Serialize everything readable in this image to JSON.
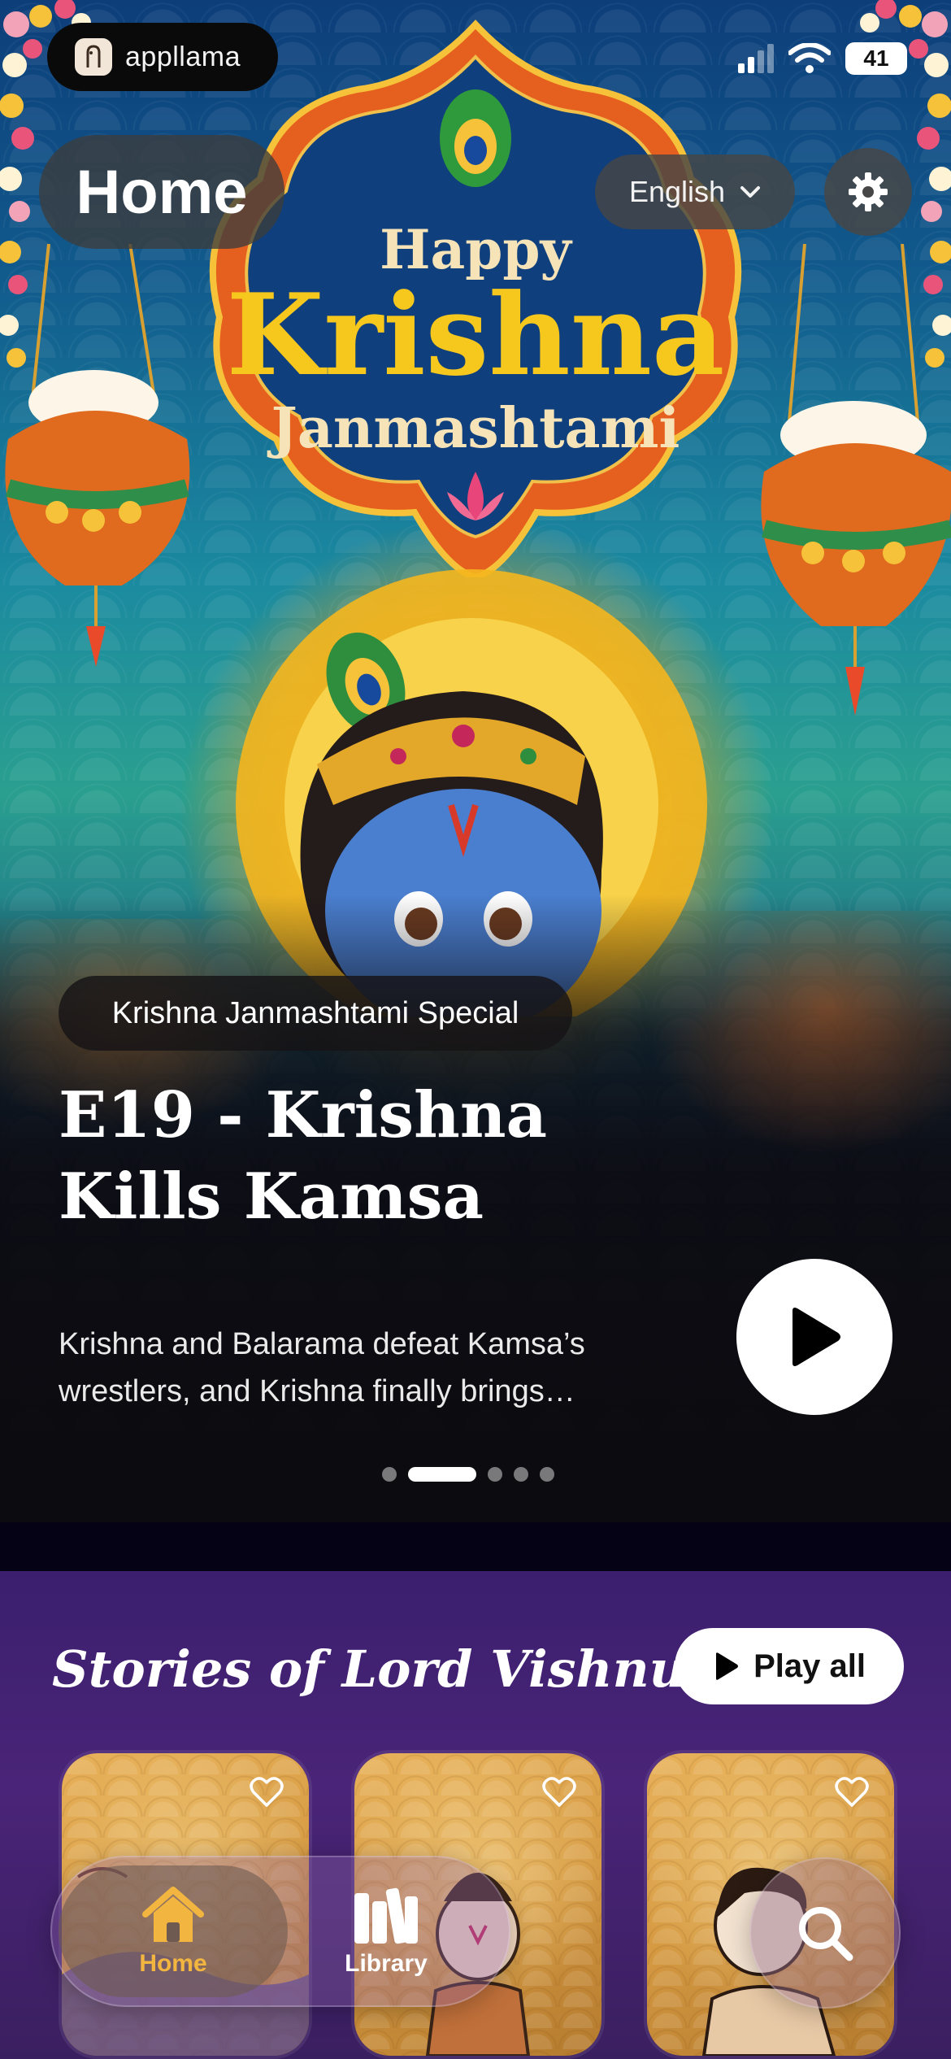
{
  "status_bar": {
    "brand": "appllama",
    "battery": "41"
  },
  "header": {
    "title": "Home",
    "language": "English"
  },
  "hero": {
    "banner_lines": [
      "Happy",
      "Krishna",
      "Janmashtami"
    ],
    "tag": "Krishna Janmashtami Special",
    "episode_title": "E19 - Krishna Kills Kamsa",
    "description": "Krishna and Balarama defeat Kamsa’s wrestlers, and Krishna finally brings…",
    "carousel": {
      "count": 5,
      "active_index": 1
    }
  },
  "section": {
    "title": "Stories of Lord Vishnu",
    "play_all_label": "Play all",
    "cards": [
      {
        "favorite": false
      },
      {
        "favorite": false
      },
      {
        "favorite": false
      }
    ]
  },
  "tabbar": {
    "home_label": "Home",
    "library_label": "Library"
  },
  "colors": {
    "accent_home": "#f2b640",
    "section_bg": "#4a2478"
  }
}
